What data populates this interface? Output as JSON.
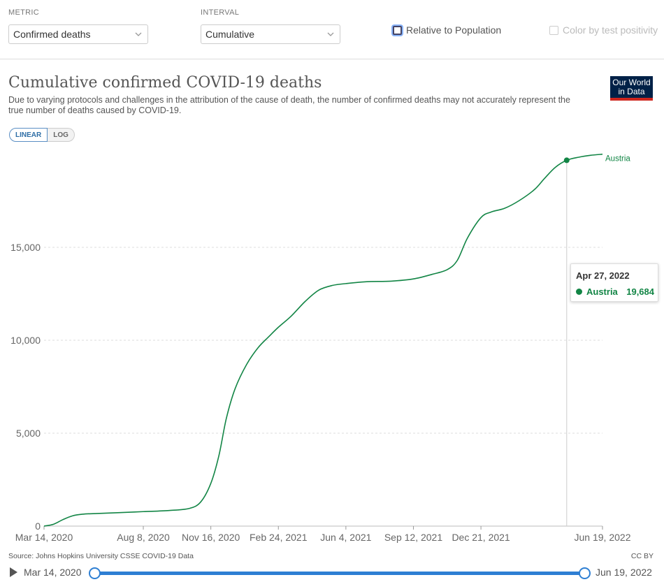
{
  "controls": {
    "metric_label": "METRIC",
    "metric_value": "Confirmed deaths",
    "interval_label": "INTERVAL",
    "interval_value": "Cumulative",
    "relative_label": "Relative to Population",
    "color_label": "Color by test positivity"
  },
  "title": "Cumulative confirmed COVID-19 deaths",
  "subtitle": "Due to varying protocols and challenges in the attribution of the cause of death, the number of confirmed deaths may not accurately represent the true number of deaths caused by COVID-19.",
  "logo": {
    "line1": "Our World",
    "line2": "in Data"
  },
  "scale_toggle": {
    "linear": "LINEAR",
    "log": "LOG"
  },
  "tooltip": {
    "date": "Apr 27, 2022",
    "series": "Austria",
    "value": "19,684"
  },
  "footer": {
    "source": "Source: Johns Hopkins University CSSE COVID-19 Data",
    "license": "CC BY"
  },
  "timeline": {
    "start": "Mar 14, 2020",
    "end": "Jun 19, 2022"
  },
  "colors": {
    "series": "#128545",
    "accent": "#2e7fd3"
  },
  "chart_data": {
    "type": "line",
    "title": "Cumulative confirmed COVID-19 deaths",
    "ylim": [
      0,
      20000
    ],
    "y_ticks": [
      0,
      5000,
      10000,
      15000
    ],
    "y_tick_labels": [
      "0",
      "5,000",
      "10,000",
      "15,000"
    ],
    "x_ticks": [
      "2020-03-14",
      "2020-08-08",
      "2020-11-16",
      "2021-02-24",
      "2021-06-04",
      "2021-09-12",
      "2021-12-21",
      "2022-06-19"
    ],
    "x_tick_labels": [
      "Mar 14, 2020",
      "Aug 8, 2020",
      "Nov 16, 2020",
      "Feb 24, 2021",
      "Jun 4, 2021",
      "Sep 12, 2021",
      "Dec 21, 2021",
      "Jun 19, 2022"
    ],
    "xlim": [
      "2020-03-14",
      "2022-06-19"
    ],
    "grid": true,
    "series": [
      {
        "name": "Austria",
        "color": "#128545",
        "points": [
          [
            "2020-03-14",
            0
          ],
          [
            "2020-03-28",
            100
          ],
          [
            "2020-04-11",
            350
          ],
          [
            "2020-04-25",
            550
          ],
          [
            "2020-05-10",
            640
          ],
          [
            "2020-06-01",
            680
          ],
          [
            "2020-07-01",
            720
          ],
          [
            "2020-08-08",
            780
          ],
          [
            "2020-09-15",
            840
          ],
          [
            "2020-10-15",
            950
          ],
          [
            "2020-11-01",
            1300
          ],
          [
            "2020-11-16",
            2300
          ],
          [
            "2020-11-28",
            3800
          ],
          [
            "2020-12-09",
            5800
          ],
          [
            "2020-12-22",
            7400
          ],
          [
            "2021-01-08",
            8700
          ],
          [
            "2021-01-25",
            9600
          ],
          [
            "2021-02-10",
            10200
          ],
          [
            "2021-02-24",
            10700
          ],
          [
            "2021-03-15",
            11300
          ],
          [
            "2021-04-05",
            12100
          ],
          [
            "2021-04-25",
            12700
          ],
          [
            "2021-05-15",
            12950
          ],
          [
            "2021-06-04",
            13050
          ],
          [
            "2021-07-05",
            13150
          ],
          [
            "2021-08-10",
            13180
          ],
          [
            "2021-09-12",
            13300
          ],
          [
            "2021-10-10",
            13550
          ],
          [
            "2021-11-01",
            13800
          ],
          [
            "2021-11-16",
            14300
          ],
          [
            "2021-12-01",
            15500
          ],
          [
            "2021-12-21",
            16600
          ],
          [
            "2022-01-05",
            16900
          ],
          [
            "2022-01-25",
            17100
          ],
          [
            "2022-02-15",
            17500
          ],
          [
            "2022-03-10",
            18100
          ],
          [
            "2022-03-25",
            18700
          ],
          [
            "2022-04-10",
            19300
          ],
          [
            "2022-04-27",
            19684
          ],
          [
            "2022-05-15",
            19850
          ],
          [
            "2022-06-01",
            19950
          ],
          [
            "2022-06-19",
            20010
          ]
        ]
      }
    ],
    "highlight": {
      "date": "2022-04-27",
      "value": 19684
    }
  }
}
